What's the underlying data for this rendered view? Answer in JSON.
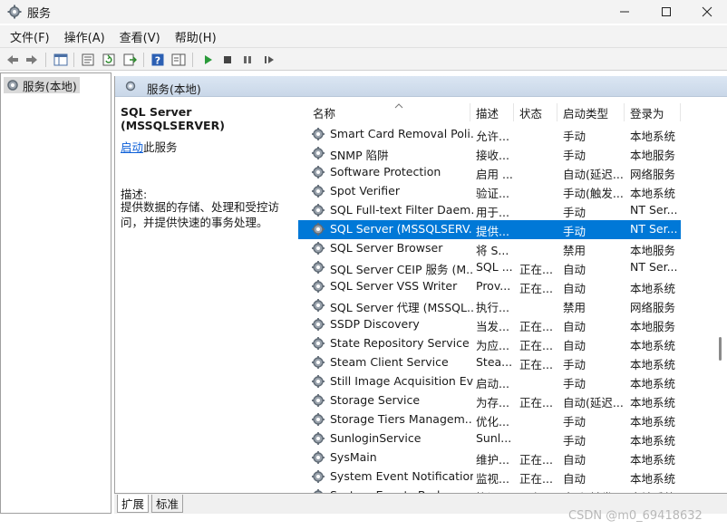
{
  "window": {
    "title": "服务"
  },
  "menu": [
    "文件(F)",
    "操作(A)",
    "查看(V)",
    "帮助(H)"
  ],
  "tree": {
    "item": "服务(本地)"
  },
  "pane": {
    "header": "服务(本地)",
    "selected_name": "SQL Server (MSSQLSERVER)",
    "start_link": "启动",
    "start_suffix": "此服务",
    "desc_label": "描述:",
    "description": "提供数据的存储、处理和受控访问，并提供快速的事务处理。"
  },
  "columns": [
    "名称",
    "描述",
    "状态",
    "启动类型",
    "登录为"
  ],
  "rows": [
    [
      "Smart Card Removal Poli...",
      "允许...",
      "",
      "手动",
      "本地系统"
    ],
    [
      "SNMP 陷阱",
      "接收...",
      "",
      "手动",
      "本地服务"
    ],
    [
      "Software Protection",
      "启用 ...",
      "",
      "自动(延迟...",
      "网络服务"
    ],
    [
      "Spot Verifier",
      "验证...",
      "",
      "手动(触发...",
      "本地系统"
    ],
    [
      "SQL Full-text Filter Daem...",
      "用于...",
      "",
      "手动",
      "NT Ser..."
    ],
    [
      "SQL Server (MSSQLSERV...",
      "提供...",
      "",
      "手动",
      "NT Ser..."
    ],
    [
      "SQL Server Browser",
      "将 S...",
      "",
      "禁用",
      "本地服务"
    ],
    [
      "SQL Server CEIP 服务 (M...",
      "SQL ...",
      "正在...",
      "自动",
      "NT Ser..."
    ],
    [
      "SQL Server VSS Writer",
      "Prov...",
      "正在...",
      "自动",
      "本地系统"
    ],
    [
      "SQL Server 代理 (MSSQL...",
      "执行...",
      "",
      "禁用",
      "网络服务"
    ],
    [
      "SSDP Discovery",
      "当发...",
      "正在...",
      "自动",
      "本地服务"
    ],
    [
      "State Repository Service",
      "为应...",
      "正在...",
      "自动",
      "本地系统"
    ],
    [
      "Steam Client Service",
      "Stea...",
      "正在...",
      "手动",
      "本地系统"
    ],
    [
      "Still Image Acquisition Ev...",
      "启动...",
      "",
      "手动",
      "本地系统"
    ],
    [
      "Storage Service",
      "为存...",
      "正在...",
      "自动(延迟...",
      "本地系统"
    ],
    [
      "Storage Tiers Managem...",
      "优化...",
      "",
      "手动",
      "本地系统"
    ],
    [
      "SunloginService",
      "Sunl...",
      "",
      "手动",
      "本地系统"
    ],
    [
      "SysMain",
      "维护...",
      "正在...",
      "自动",
      "本地系统"
    ],
    [
      "System Event Notification...",
      "监视...",
      "正在...",
      "自动",
      "本地系统"
    ],
    [
      "System Events Broker",
      "协调...",
      "正在...",
      "自动(触发...",
      "本地系统"
    ]
  ],
  "selected_row": 5,
  "tabs": [
    "扩展",
    "标准"
  ],
  "watermark": "CSDN @m0_69418632",
  "colors": {
    "selection": "#0078d7",
    "link": "#0b5ed7",
    "header": "#dbe6f3"
  }
}
